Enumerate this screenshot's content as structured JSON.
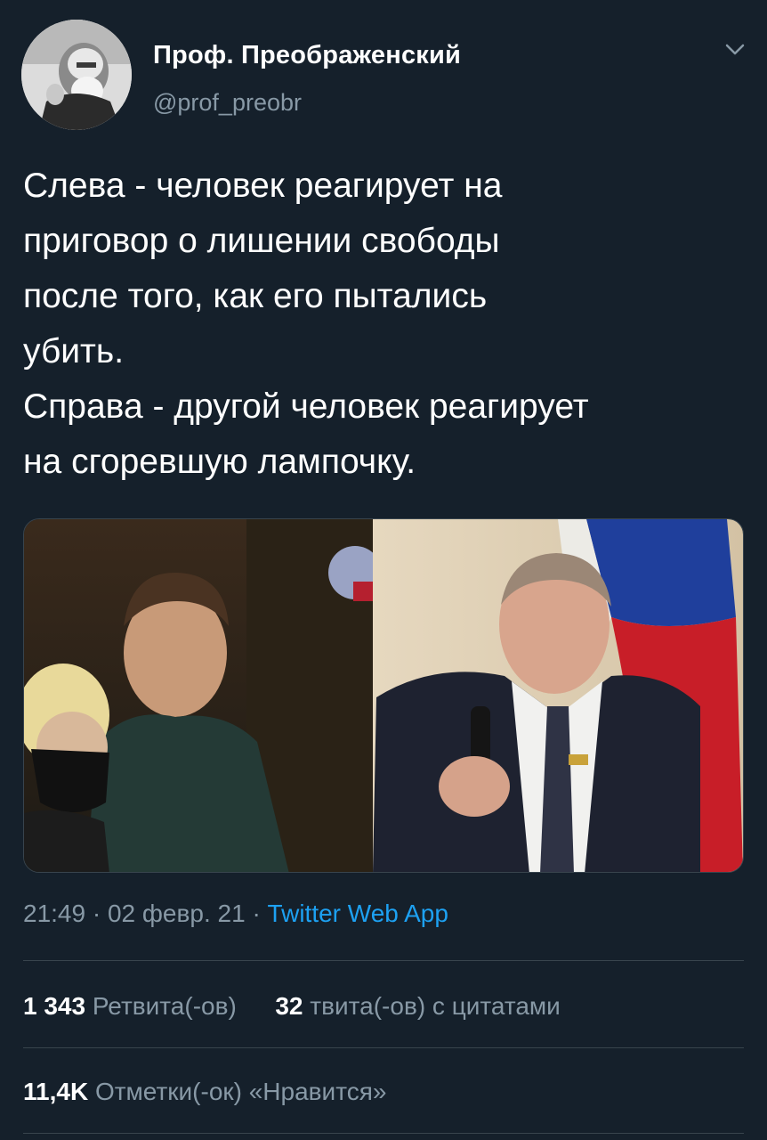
{
  "author": {
    "name": "Проф. Преображенский",
    "handle": "@prof_preobr"
  },
  "tweet": {
    "lines": [
      "Слева - человек реагирует на",
      "приговор о лишении свободы",
      "после того, как его пытались",
      "убить.",
      "Справа - другой человек реагирует",
      "на сгоревшую лампочку."
    ]
  },
  "meta": {
    "time": "21:49",
    "date": "02 февр. 21",
    "separator": "·",
    "app": "Twitter Web App"
  },
  "stats": {
    "retweets_count": "1 343",
    "retweets_label": "Ретвита(-ов)",
    "quotes_count": "32",
    "quotes_label": "твита(-ов) с цитатами",
    "likes_count": "11,4K",
    "likes_label": "Отметки(-ок) «Нравится»"
  },
  "icons": {
    "caret": "chevron-down-icon"
  },
  "colors": {
    "background": "#15202b",
    "secondary_text": "#8899a6",
    "link": "#1da1f2",
    "divider": "#38444d"
  }
}
